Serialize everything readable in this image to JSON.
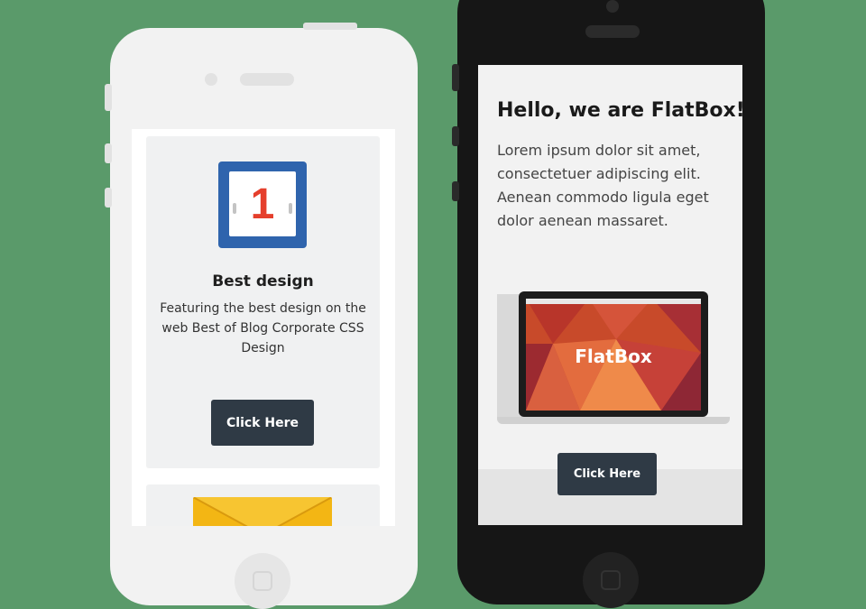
{
  "left_phone": {
    "card": {
      "icon_number": "1",
      "title": "Best design",
      "description": "Featuring the best design on the web Best of Blog Corporate CSS Design",
      "button_label": "Click Here"
    },
    "next_card_icon": "envelope-icon"
  },
  "right_phone": {
    "heading": "Hello, we are FlatBox!",
    "body": "Lorem ipsum dolor sit amet, consectetuer adipiscing elit. Aenean commodo ligula eget dolor aenean massaret.",
    "laptop_screen_text": "FlatBox",
    "button_label": "Click Here"
  },
  "colors": {
    "background": "#5a9a6a",
    "button": "#2f3a45",
    "calendar_blue": "#2f64ad",
    "calendar_red": "#e53f2c",
    "envelope_yellow": "#f3b614"
  }
}
